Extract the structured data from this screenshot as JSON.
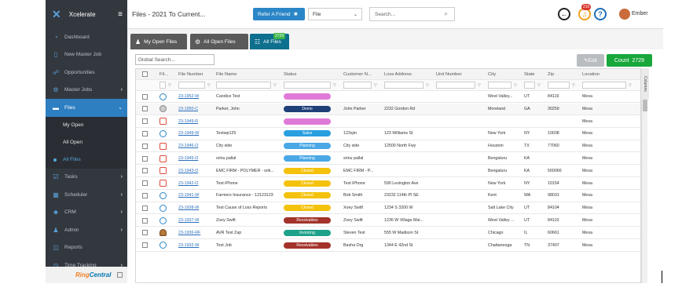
{
  "sidebar": {
    "brand": "Xcelerate",
    "items": [
      {
        "label": "Dashboard",
        "icon": "palette-icon",
        "glyph": "◔",
        "chev": ""
      },
      {
        "label": "New Master Job",
        "icon": "new-job-icon",
        "glyph": "▯",
        "chev": ""
      },
      {
        "label": "Opportunities",
        "icon": "opportunities-icon",
        "glyph": "☍",
        "chev": ""
      },
      {
        "label": "Master Jobs",
        "icon": "master-jobs-icon",
        "glyph": "⚙",
        "chev": "›"
      },
      {
        "label": "Files",
        "icon": "folder-icon",
        "glyph": "▬",
        "chev": "⌄"
      },
      {
        "label": "Tasks",
        "icon": "tasks-icon",
        "glyph": "☑",
        "chev": "›"
      },
      {
        "label": "Scheduler",
        "icon": "calendar-icon",
        "glyph": "▦",
        "chev": "›"
      },
      {
        "label": "CRM",
        "icon": "crm-icon",
        "glyph": "☻",
        "chev": "›"
      },
      {
        "label": "Admin",
        "icon": "admin-icon",
        "glyph": "♟",
        "chev": "›"
      },
      {
        "label": "Reports",
        "icon": "reports-icon",
        "glyph": "◫",
        "chev": ""
      },
      {
        "label": "Time Tracking",
        "icon": "clock-icon",
        "glyph": "◷",
        "chev": "›"
      }
    ],
    "files_sub": [
      "My Open",
      "All Open",
      "All Files"
    ],
    "ringcentral": {
      "r1": "Ring",
      "r2": "Central"
    }
  },
  "topbar": {
    "title": "Files - 2021 To Current...",
    "refer": "Refer A Friend",
    "file_select": "File",
    "search_placeholder": "Search...",
    "notif_count": "210",
    "user": "Ember"
  },
  "tabs": [
    {
      "label": "My Open Files",
      "icon": "person-icon",
      "glyph": "♟"
    },
    {
      "label": "All Open Files",
      "icon": "gears-icon",
      "glyph": "⚙"
    },
    {
      "label": "All Files",
      "icon": "people-icon",
      "glyph": "☷"
    }
  ],
  "tab_badge": "2729",
  "toolbar": {
    "global_search": "Global Search...",
    "edit": "Edit",
    "count_label": "Count",
    "count": "2729"
  },
  "columns": [
    "",
    "Fil...",
    "File Number",
    "File Name",
    "Status",
    "Customer N...",
    "Loss Address",
    "Unit Number",
    "City",
    "State",
    "Zip",
    "Location"
  ],
  "columns_tab": "Columns",
  "rows": [
    {
      "icon": "blue",
      "num": "23-1952-W",
      "name": "Candice Test",
      "status": "",
      "sc": "#e07ad9",
      "cust": "",
      "addr": "",
      "unit": "",
      "city": "West Valley...",
      "state": "UT",
      "zip": "84119",
      "loc": "Mesa"
    },
    {
      "icon": "gray",
      "num": "23-1950-C",
      "name": "Parker, John",
      "status": "Demo",
      "sc": "#1e3f78",
      "cust": "John Parker",
      "addr": "2232 Gordon Rd",
      "unit": "",
      "city": "Moreland",
      "state": "GA",
      "zip": "30259",
      "loc": "Mesa"
    },
    {
      "icon": "red",
      "num": "23-1949-R",
      "name": "",
      "status": "",
      "sc": "#e07ad9",
      "cust": "",
      "addr": "",
      "unit": "",
      "city": "",
      "state": "",
      "zip": "",
      "loc": "Mesa"
    },
    {
      "icon": "blue",
      "num": "23-1949-W",
      "name": "Testwp125",
      "status": "Sales",
      "sc": "#2a9fe0",
      "cust": "123sjm",
      "addr": "123 Williams St",
      "unit": "",
      "city": "New York",
      "state": "NY",
      "zip": "10038",
      "loc": "Mesa"
    },
    {
      "icon": "red",
      "num": "23-1946-O",
      "name": "City side",
      "status": "Planning",
      "sc": "#4aa8e6",
      "cust": "City side",
      "addr": "12500 North Fwy",
      "unit": "",
      "city": "Houston",
      "state": "TX",
      "zip": "77060",
      "loc": "Mesa"
    },
    {
      "icon": "red",
      "num": "23-1945-O",
      "name": "srinu pallal",
      "status": "Planning",
      "sc": "#4aa8e6",
      "cust": "srinu pallal",
      "addr": "",
      "unit": "",
      "city": "Bengaluru",
      "state": "KA",
      "zip": "",
      "loc": "Mesa"
    },
    {
      "icon": "red",
      "num": "23-1943-O",
      "name": "EMC FIRM - POLYMER - srik...",
      "status": "Closed",
      "sc": "#f4c20d",
      "cust": "EMC FIRM - P...",
      "addr": "",
      "unit": "",
      "city": "Bengaluru",
      "state": "KA",
      "zip": "560066",
      "loc": "Mesa"
    },
    {
      "icon": "red",
      "num": "23-1942-O",
      "name": "Test iPhone",
      "status": "Closed",
      "sc": "#f4c20d",
      "cust": "Test iPhone",
      "addr": "590 Lexington Ave",
      "unit": "",
      "city": "New York",
      "state": "NY",
      "zip": "10154",
      "loc": "Mesa"
    },
    {
      "icon": "blue",
      "num": "23-1941-W",
      "name": "Farmers Insurance - 12123123",
      "status": "Closed",
      "sc": "#f4c20d",
      "cust": "Bob Smith",
      "addr": "23232 114th Pl SE",
      "unit": "",
      "city": "Kent",
      "state": "WA",
      "zip": "98031",
      "loc": "Mesa"
    },
    {
      "icon": "blue",
      "num": "23-1938-W",
      "name": "Test Cause of Loss Reports",
      "status": "Closed",
      "sc": "#f4c20d",
      "cust": "Xoey Swift",
      "addr": "1234 S 3200 W",
      "unit": "",
      "city": "Salt Lake City",
      "state": "UT",
      "zip": "84104",
      "loc": "Mesa"
    },
    {
      "icon": "blue",
      "num": "23-1937-W",
      "name": "Zoey Swift",
      "status": "Receivables",
      "sc": "#a3332b",
      "cust": "Zoey Swift",
      "addr": "1236 W Village Mai...",
      "unit": "",
      "city": "West Valley ...",
      "state": "UT",
      "zip": "84119",
      "loc": "Mesa"
    },
    {
      "icon": "brown",
      "num": "23-1936-RF",
      "name": "AVR Test Zap",
      "status": "Invoicing",
      "sc": "#1ea18a",
      "cust": "Steven Test",
      "addr": "555 W Madison St",
      "unit": "",
      "city": "Chicago",
      "state": "IL",
      "zip": "60661",
      "loc": "Mesa"
    },
    {
      "icon": "blue",
      "num": "23-1932-W",
      "name": "Test Job",
      "status": "Receivables",
      "sc": "#a3332b",
      "cust": "Basha Org",
      "addr": "1344 E 42nd St",
      "unit": "",
      "city": "Chattanooga",
      "state": "TN",
      "zip": "37407",
      "loc": "Mesa"
    }
  ]
}
